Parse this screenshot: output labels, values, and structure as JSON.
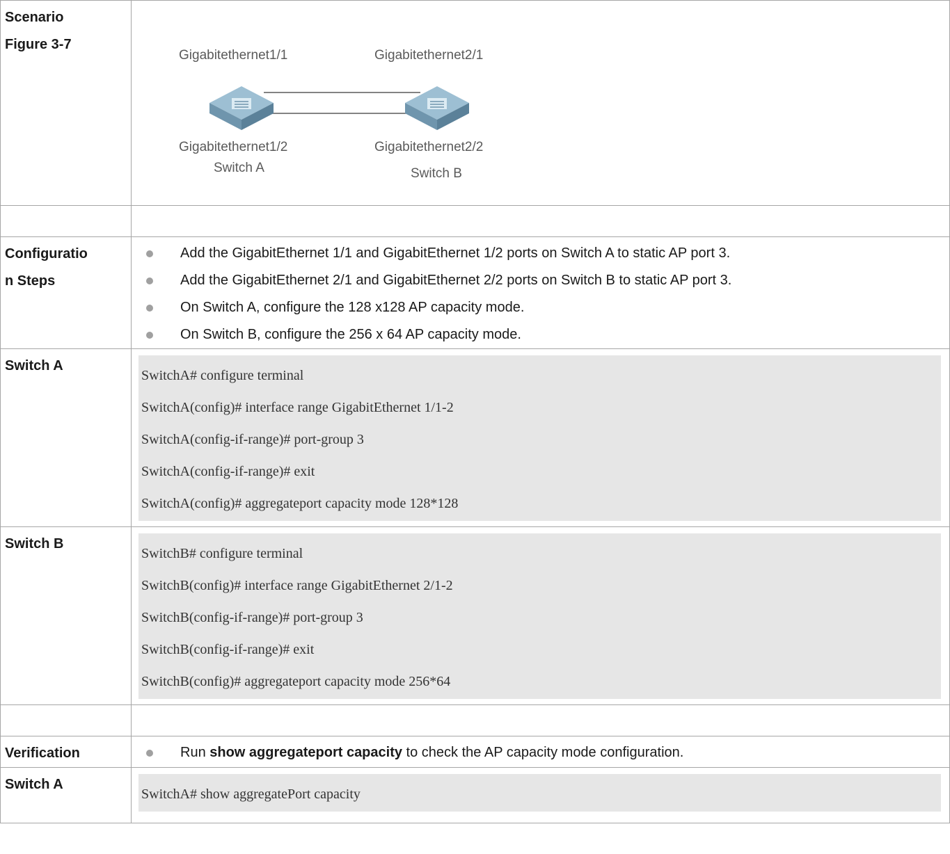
{
  "rows": {
    "scenario": {
      "label_line1": "Scenario",
      "label_line2": "Figure 3-7",
      "figure": {
        "top_left_port": "Gigabitethernet1/1",
        "top_right_port": "Gigabitethernet2/1",
        "bottom_left_port": "Gigabitethernet1/2",
        "bottom_right_port": "Gigabitethernet2/2",
        "switch_a_name": "Switch A",
        "switch_b_name": "Switch B",
        "switch_icon": "network-switch-icon"
      }
    },
    "configuration": {
      "label_line1": "Configuratio",
      "label_line2": "n Steps",
      "steps": [
        "Add the GigabitEthernet 1/1 and GigabitEthernet 1/2 ports on Switch A to static AP port 3.",
        "Add the GigabitEthernet 2/1 and GigabitEthernet 2/2 ports on Switch B to static AP port 3.",
        "On Switch A, configure the 128 x128 AP capacity mode.",
        "On Switch B, configure the 256 x 64 AP capacity mode."
      ]
    },
    "switch_a": {
      "label": "Switch A",
      "code": [
        "SwitchA# configure terminal",
        "SwitchA(config)# interface range GigabitEthernet 1/1-2",
        "SwitchA(config-if-range)# port-group 3",
        "SwitchA(config-if-range)# exit",
        "SwitchA(config)# aggregateport capacity mode 128*128"
      ]
    },
    "switch_b": {
      "label": "Switch B",
      "code": [
        "SwitchB# configure terminal",
        "SwitchB(config)# interface range GigabitEthernet 2/1-2",
        "SwitchB(config-if-range)# port-group 3",
        "SwitchB(config-if-range)# exit",
        "SwitchB(config)# aggregateport capacity mode 256*64"
      ]
    },
    "verification": {
      "label": "Verification",
      "text_before": "Run ",
      "text_bold": "show aggregateport capacity",
      "text_after": " to check the AP capacity mode configuration."
    },
    "switch_a_verify": {
      "label": "Switch A",
      "code": [
        "SwitchA# show aggregatePort capacity"
      ]
    }
  },
  "colors": {
    "border": "#a6a6a6",
    "code_background": "#e6e6e6",
    "bullet": "#a0a0a0",
    "switch_body": "#8fb2c8"
  }
}
